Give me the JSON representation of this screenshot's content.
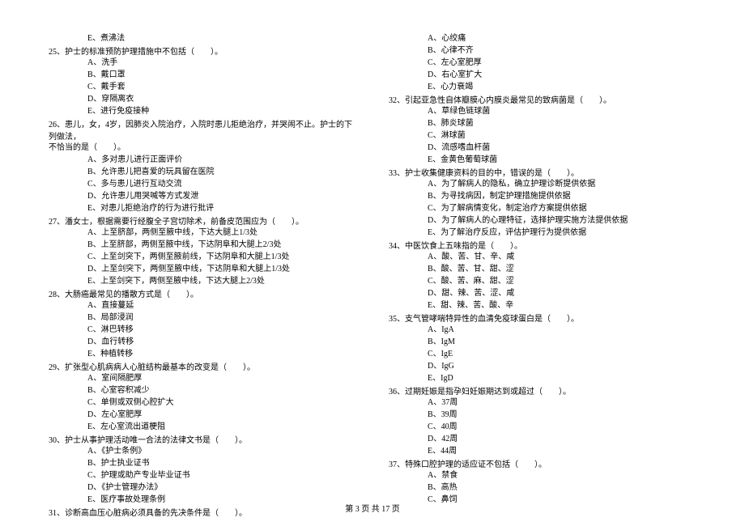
{
  "left_col": {
    "option_e_top": "E、煮沸法",
    "q25": {
      "text": "25、护士的标准预防护理措施中不包括（　　）。",
      "opts": [
        "A、洗手",
        "B、戴口罩",
        "C、戴手套",
        "D、穿隔离衣",
        "E、进行免疫接种"
      ]
    },
    "q26": {
      "text": "26、患儿，女，4岁，因肺炎入院治疗，入院时患儿拒绝治疗，并哭闹不止。护士的下列做法，",
      "cont": "不恰当的是（　　）。",
      "opts": [
        "A、多对患儿进行正面评价",
        "B、允许患儿把喜爱的玩具留在医院",
        "C、多与患儿进行互动交流",
        "D、允许患儿用哭喊等方式发泄",
        "E、对患儿拒绝治疗的行为进行批评"
      ]
    },
    "q27": {
      "text": "27、潘女士，根据需要行经腹全子宫切除术，前备皮范围应为（　　）。",
      "opts": [
        "A、上至脐部，两侧至腋中线，下达大腿上1/3处",
        "B、上至脐部，两侧至腋中线，下达阴阜和大腿上2/3处",
        "C、上至剑突下，两侧至腋前线，下达阴阜和大腿上1/3处",
        "D、上至剑突下，两侧至腋中线，下达阴阜和大腿上1/3处",
        "E、上至剑突下，两侧至腋中线，下达大腿上2/3处"
      ]
    },
    "q28": {
      "text": "28、大肠癌最常见的播散方式是（　　）。",
      "opts": [
        "A、直接蔓延",
        "B、局部浸润",
        "C、淋巴转移",
        "D、血行转移",
        "E、种植转移"
      ]
    },
    "q29": {
      "text": "29、扩张型心肌病病人心脏结构最基本的改变是（　　）。",
      "opts": [
        "A、室间隔肥厚",
        "B、心室容积减少",
        "C、单侧或双侧心腔扩大",
        "D、左心室肥厚",
        "E、左心室流出道梗阻"
      ]
    },
    "q30": {
      "text": "30、护士从事护理活动唯一合法的法律文书是（　　）。",
      "opts": [
        "A、《护士条例》",
        "B、护士执业证书",
        "C、护理或助产专业毕业证书",
        "D、《护士管理办法》",
        "E、医疗事故处理条例"
      ]
    },
    "q31": {
      "text": "31、诊断高血压心脏病必须具备的先决条件是（　　）。"
    }
  },
  "right_col": {
    "q31_opts": [
      "A、心绞痛",
      "B、心律不齐",
      "C、左心室肥厚",
      "D、右心室扩大",
      "E、心力衰竭"
    ],
    "q32": {
      "text": "32、引起亚急性自体瓣膜心内膜炎最常见的致病菌是（　　）。",
      "opts": [
        "A、草绿色链球菌",
        "B、肺炎球菌",
        "C、淋球菌",
        "D、流感嗜血杆菌",
        "E、金黄色葡萄球菌"
      ]
    },
    "q33": {
      "text": "33、护士收集健康资料的目的中，错误的是（　　）。",
      "opts": [
        "A、为了解病人的隐私，确立护理诊断提供依据",
        "B、为寻找病因，制定护理措施提供依据",
        "C、为了解病情变化，制定治疗方案提供依据",
        "D、为了解病人的心理特征，选择护理实施方法提供依据",
        "E、为了解治疗反应，评估护理行为提供依据"
      ]
    },
    "q34": {
      "text": "34、中医饮食上五味指的是（　　）。",
      "opts": [
        "A、酸、苦、甘、辛、咸",
        "B、酸、苦、甘、甜、涩",
        "C、酸、苦、麻、甜、涩",
        "D、甜、辣、苦、涩、咸",
        "E、甜、辣、苦、酸、辛"
      ]
    },
    "q35": {
      "text": "35、支气管哮喘特异性的血清免疫球蛋白是（　　）。",
      "opts": [
        "A、IgA",
        "B、IgM",
        "C、IgE",
        "D、IgG",
        "E、IgD"
      ]
    },
    "q36": {
      "text": "36、过期妊娠是指孕妇妊娠期达到或超过（　　）。",
      "opts": [
        "A、37周",
        "B、39周",
        "C、40周",
        "D、42周",
        "E、44周"
      ]
    },
    "q37": {
      "text": "37、特殊口腔护理的适应证不包括（　　）。",
      "opts": [
        "A、禁食",
        "B、高热",
        "C、鼻饲"
      ]
    }
  },
  "footer": "第 3 页 共 17 页"
}
